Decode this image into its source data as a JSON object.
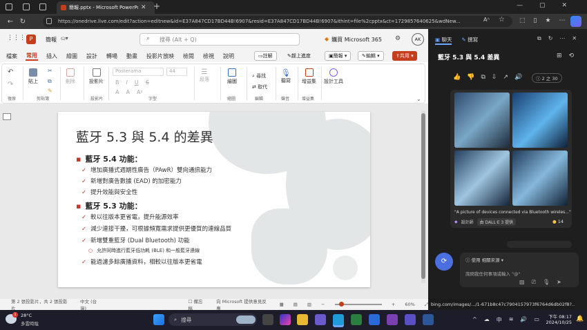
{
  "browser": {
    "tab_title": "簡報.pptx - Microsoft PowerPoint",
    "url": "https://onedrive.live.com/edit?action=editnew&id=E37A847CD17BD44B!6907&resid=E37A847CD17BD44B!6907&ithint=file%2cpptx&ct=1729857640625&wdNew...",
    "reader_label": "Aᴬ"
  },
  "app": {
    "doc_name": "簡報",
    "search_placeholder": "搜尋 (Alt + Q)",
    "buy_label": "購買 Microsoft 365",
    "avatar": "AK"
  },
  "ribbon_tabs": [
    "檔案",
    "常用",
    "插入",
    "繪圖",
    "設計",
    "轉場",
    "動畫",
    "投影片放映",
    "檢閱",
    "檢視",
    "說明"
  ],
  "ribbon_actions": {
    "comment": "註解",
    "catchup": "趕上進度",
    "present": "簡報",
    "edit": "編輯",
    "share": "共用"
  },
  "ribbon": {
    "undo_group": "復原",
    "clipboard_group": "剪貼簿",
    "paste": "貼上",
    "delete": "刪除",
    "slides_group": "投影片",
    "new_slide": "投影片",
    "font_group": "字型",
    "font_name": "Posterama",
    "font_size": "44",
    "paragraph": "段落",
    "paragraph_group": "段落",
    "draw": "繪圖",
    "draw_group": "繪圖",
    "find": "尋找",
    "replace": "取代",
    "edit_group": "編輯",
    "dictate": "聽寫",
    "voice_group": "聲音",
    "addins": "增益集",
    "addins_group": "增益集",
    "designer": "設計工具"
  },
  "slide": {
    "title": "藍牙 5.3 與 5.4 的差異",
    "h1": "藍牙 5.4 功能：",
    "b1": "增加廣播式週期性廣告（PAwR）雙向通訊能力",
    "b2": "新增對廣告數據 (EAD) 的加密能力",
    "b3": "提升效能與安全性",
    "h2": "藍牙 5.3 功能：",
    "c1": "較以往版本更省電，提升能源效率",
    "c2": "減少連接干擾，可根據頻寬需求提供更優質的連線品質",
    "c3": "新增雙重藍牙 (Dual Bluetooth) 功能",
    "c3a": "允許同時進行藍牙低功耗 (BLE) 和一般藍牙連線",
    "c4": "能過濾多餘廣播資料，相較以往版本更省電"
  },
  "status": {
    "slide_pos": "第 2 張投影片，共 2 張投影片",
    "lang": "中文 (台灣)",
    "notes": "備忘稿",
    "feedback": "向 Microsoft 提供意見反應",
    "zoom": "60%"
  },
  "side": {
    "tab_chat": "聊天",
    "tab_compose": "撰寫",
    "title": "藍牙 5.3 與 5.4 差異",
    "counter": "2 之 30",
    "caption": "\"A picture of devices connected via Bluetooth wireles...\"",
    "designer": "設計師",
    "dalle": "由 DALL·E 3 提供",
    "coins": "14",
    "source_label": "使用 相關來源",
    "input_placeholder": "詢問我任何事項或輸入 \"@\"",
    "link": "bing.com/images/.../1-671b8c47c7904157973f6764d6db02f8?..."
  },
  "taskbar": {
    "temp": "28°C",
    "weather": "多雲時陰",
    "search": "搜尋",
    "ime": "中",
    "time": "下午 08:17",
    "date": "2024/10/25",
    "badge": "1"
  }
}
